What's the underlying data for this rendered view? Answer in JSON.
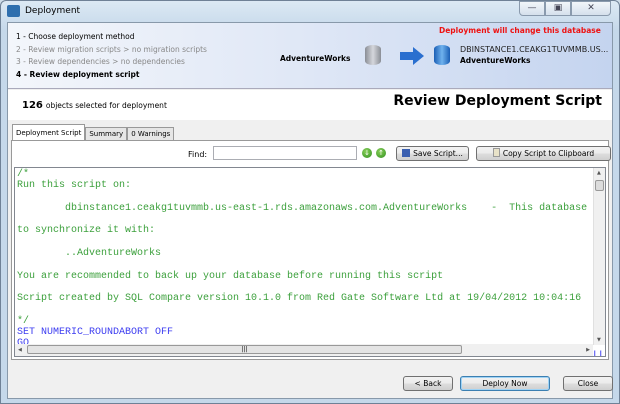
{
  "window": {
    "title": "Deployment",
    "controls": [
      "minimize",
      "maximize",
      "close"
    ]
  },
  "steps": [
    {
      "label": "1 - Choose deployment method",
      "state": "done"
    },
    {
      "label": "2 - Review migration scripts > no migration scripts",
      "state": "disabled"
    },
    {
      "label": "3 - Review dependencies > no dependencies",
      "state": "disabled"
    },
    {
      "label": "4 - Review deployment script",
      "state": "current"
    }
  ],
  "source_db": "AdventureWorks",
  "warning": "Deployment will change this database",
  "target": {
    "server": "DBINSTANCE1.CEAKG1TUVMMB.US...",
    "db": "AdventureWorks"
  },
  "summary": {
    "count": "126",
    "text": "objects selected for deployment"
  },
  "page_title": "Review Deployment Script",
  "tabs": [
    "Deployment Script",
    "Summary",
    "0 Warnings"
  ],
  "find_label": "Find:",
  "find_value": "",
  "buttons": {
    "save": "Save Script...",
    "copy": "Copy Script to Clipboard",
    "back": "< Back",
    "deploy": "Deploy Now",
    "close": "Close"
  },
  "script": {
    "comment": "/*\nRun this script on:\n\n        dbinstance1.ceakg1tuvmmb.us-east-1.rds.amazonaws.com.AdventureWorks    -  This database will be\n\nto synchronize it with:\n\n        ..AdventureWorks\n\nYou are recommended to back up your database before running this script\n\nScript created by SQL Compare version 10.1.0 from Red Gate Software Ltd at 19/04/2012 10:04:16\n\n*/",
    "sql": "SET NUMERIC_ROUNDABORT OFF\nGO\nSET ANSI_PADDING, ANSI_WARNINGS, CONCAT_NULL_YIELDS_NULL, ARITHABORT, QUOTED_IDENTIFIER, ANSI_NULLS ON"
  },
  "colors": {
    "comment": "#3ca03c",
    "keyword": "#3c3cf0",
    "warning": "#ee1111"
  }
}
